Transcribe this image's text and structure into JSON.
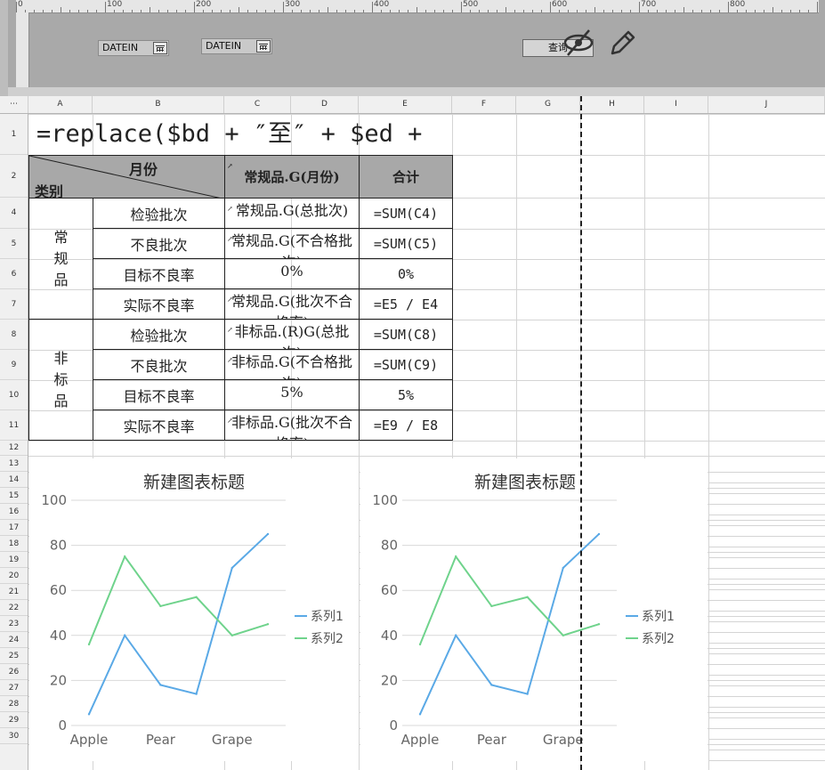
{
  "ruler": {
    "ticks": [
      "0",
      "100",
      "200",
      "300",
      "400",
      "500",
      "600",
      "700",
      "800"
    ]
  },
  "params": {
    "date1_label": "DATEIN",
    "date2_label": "DATEIN",
    "query_label": "查询"
  },
  "columns": [
    "A",
    "B",
    "C",
    "D",
    "E",
    "F",
    "G",
    "H",
    "I",
    "J"
  ],
  "rows": [
    "1",
    "2",
    "4",
    "5",
    "6",
    "7",
    "8",
    "9",
    "10",
    "11",
    "12",
    "13",
    "14",
    "15",
    "16",
    "17",
    "18",
    "19",
    "20",
    "21",
    "22",
    "23",
    "24",
    "25",
    "26",
    "27",
    "28",
    "29",
    "30"
  ],
  "report": {
    "formula": "=replace($bd + ″至″ + $ed +",
    "header": {
      "diag_top": "月份",
      "diag_bottom": "类别",
      "col_c": "常规品.G(月份)",
      "col_e": "合计"
    },
    "group1": "常规品",
    "group2": "非标品",
    "rows": [
      {
        "label": "检验批次",
        "c": "常规品.G(总批次)",
        "e": "=SUM(C4)"
      },
      {
        "label": "不良批次",
        "c": "常规品.G(不合格批次)",
        "e": "=SUM(C5)"
      },
      {
        "label": "目标不良率",
        "c": "0%",
        "e": "0%"
      },
      {
        "label": "实际不良率",
        "c": "常规品.G(批次不合格率)",
        "e": "=E5 / E4"
      },
      {
        "label": "检验批次",
        "c": "非标品.(R)G(总批次)",
        "e": "=SUM(C8)"
      },
      {
        "label": "不良批次",
        "c": "非标品.G(不合格批次)",
        "e": "=SUM(C9)"
      },
      {
        "label": "目标不良率",
        "c": "5%",
        "e": "5%"
      },
      {
        "label": "实际不良率",
        "c": "非标品.G(批次不合格率)",
        "e": "=E9 / E8"
      }
    ]
  },
  "colors": {
    "series1": "#5aa9e6",
    "series2": "#6fd38c",
    "header_bg": "#a8a8a8"
  },
  "chart_data": [
    {
      "type": "line",
      "title": "新建图表标题",
      "x": [
        "Apple",
        "",
        "Pear",
        "",
        "Grape",
        ""
      ],
      "ylim": [
        0,
        100
      ],
      "yticks": [
        0,
        20,
        40,
        60,
        80,
        100
      ],
      "grid": true,
      "legend": "right",
      "series": [
        {
          "name": "系列1",
          "values": [
            5,
            40,
            18,
            14,
            70,
            85
          ]
        },
        {
          "name": "系列2",
          "values": [
            36,
            75,
            53,
            57,
            40,
            45
          ]
        }
      ]
    },
    {
      "type": "line",
      "title": "新建图表标题",
      "x": [
        "Apple",
        "",
        "Pear",
        "",
        "Grape",
        ""
      ],
      "ylim": [
        0,
        100
      ],
      "yticks": [
        0,
        20,
        40,
        60,
        80,
        100
      ],
      "grid": true,
      "legend": "right",
      "series": [
        {
          "name": "系列1",
          "values": [
            5,
            40,
            18,
            14,
            70,
            85
          ]
        },
        {
          "name": "系列2",
          "values": [
            36,
            75,
            53,
            57,
            40,
            45
          ]
        }
      ]
    }
  ]
}
